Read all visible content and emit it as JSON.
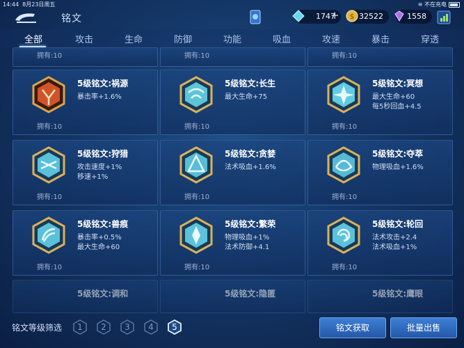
{
  "status_bar": {
    "time": "14:44",
    "date": "8月23日周五",
    "charging": "不在充电"
  },
  "header": {
    "title": "铭文",
    "currencies": [
      {
        "icon": "diamond-icon",
        "value": "1747"
      },
      {
        "icon": "gold-coin-icon",
        "value": "32522"
      },
      {
        "icon": "gem-icon",
        "value": "1558"
      }
    ]
  },
  "tabs": [
    "全部",
    "攻击",
    "生命",
    "防御",
    "功能",
    "吸血",
    "攻速",
    "暴击",
    "穿透"
  ],
  "active_tab": "全部",
  "top_partial_owned": [
    "拥有:10",
    "拥有:10",
    "拥有:10"
  ],
  "cards": [
    {
      "name": "5级铭文:祸源",
      "stats": [
        "暴击率+1.6%"
      ],
      "owned": "拥有:10",
      "color": "#d0532a"
    },
    {
      "name": "5级铭文:长生",
      "stats": [
        "最大生命+75"
      ],
      "owned": "拥有:10",
      "color": "#5fc4d8"
    },
    {
      "name": "5级铭文:冥想",
      "stats": [
        "最大生命+60",
        "每5秒回血+4.5"
      ],
      "owned": "拥有:10",
      "color": "#62cbe0"
    },
    {
      "name": "5级铭文:狩猎",
      "stats": [
        "攻击速度+1%",
        "移速+1%"
      ],
      "owned": "拥有:10",
      "color": "#5bc0da"
    },
    {
      "name": "5级铭文:贪婪",
      "stats": [
        "法术吸血+1.6%"
      ],
      "owned": "拥有:10",
      "color": "#58bdd6"
    },
    {
      "name": "5级铭文:夺萃",
      "stats": [
        "物理吸血+1.6%"
      ],
      "owned": "拥有:10",
      "color": "#56bad6"
    },
    {
      "name": "5级铭文:兽痕",
      "stats": [
        "暴击率+0.5%",
        "最大生命+60"
      ],
      "owned": "拥有:10",
      "color": "#5bc0da"
    },
    {
      "name": "5级铭文:繁荣",
      "stats": [
        "物理吸血+1%",
        "法术防御+4.1"
      ],
      "owned": "拥有:10",
      "color": "#5dc3dc"
    },
    {
      "name": "5级铭文:轮回",
      "stats": [
        "法术攻击+2.4",
        "法术吸血+1%"
      ],
      "owned": "拥有:10",
      "color": "#5bc2dc"
    }
  ],
  "bottom_partial_names": [
    "5级铭文:调和",
    "5级铭文:隐匿",
    "5级铭文:鹰眼"
  ],
  "footer": {
    "filter_label": "铭文等级筛选",
    "levels": [
      "1",
      "2",
      "3",
      "4",
      "5"
    ],
    "selected_level": "5",
    "obtain_button": "铭文获取",
    "sell_button": "批量出售"
  }
}
